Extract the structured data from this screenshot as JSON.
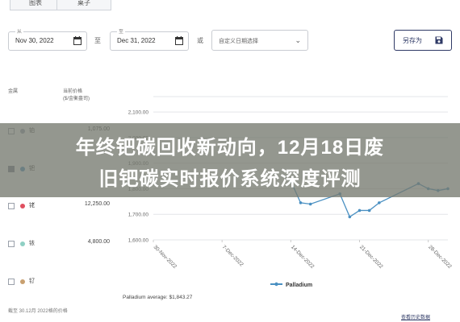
{
  "tabs": [
    {
      "label": "图表"
    },
    {
      "label": "桌子"
    }
  ],
  "filters": {
    "from": {
      "label": "从",
      "value": "Nov 30, 2022"
    },
    "to_sep": "至",
    "to": {
      "label": "至",
      "value": "Dec 31, 2022"
    },
    "range_sep": "或",
    "custom_range": {
      "placeholder": "自定义日期选择"
    },
    "save": {
      "label": "另存为"
    }
  },
  "legend": {
    "col_metal": "金属",
    "col_price_title": "当前价格",
    "col_price_unit": "($/金衡盎司)",
    "rows": [
      {
        "name": "铂",
        "price": "1,075.00",
        "checked": false,
        "color": "#9aa3b5"
      },
      {
        "name": "钯",
        "price": "",
        "checked": true,
        "color": "#4a90c2"
      },
      {
        "name": "铑",
        "price": "12,250.00",
        "checked": false,
        "color": "#e05060"
      },
      {
        "name": "铱",
        "price": "4,800.00",
        "checked": false,
        "color": "#8fd0c4"
      },
      {
        "name": "钌",
        "price": "",
        "checked": false,
        "color": "#c8a070"
      }
    ]
  },
  "footer": {
    "note": "截至 30.12月 2022格的价格",
    "link": "查看历史数据"
  },
  "chart_data": {
    "type": "line",
    "y_ticks": [
      "2,100.00",
      "2,000.00",
      "1,900.00",
      "1,800.00",
      "1,700.00",
      "1,600.00"
    ],
    "ylim": [
      1600,
      2160
    ],
    "x_ticks": [
      "30-Nov-2022",
      "7-Dec-2022",
      "14-Dec-2022",
      "21-Dec-2022",
      "28-Dec-2022"
    ],
    "series": [
      {
        "name": "Palladium",
        "color": "#4a90c2",
        "x": [
          "2022-12-14",
          "2022-12-15",
          "2022-12-16",
          "2022-12-19",
          "2022-12-20",
          "2022-12-21",
          "2022-12-22",
          "2022-12-23",
          "2022-12-27",
          "2022-12-28",
          "2022-12-29",
          "2022-12-30"
        ],
        "y": [
          1830,
          1745,
          1740,
          1780,
          1690,
          1715,
          1715,
          1745,
          1820,
          1800,
          1793,
          1800
        ]
      }
    ],
    "average_label": "Palladium average: $1,843.27",
    "grid": true
  },
  "overlay": {
    "line1": "年终钯碳回收新动向，12月18日废",
    "line2": "旧钯碳实时报价系统深度评测"
  }
}
